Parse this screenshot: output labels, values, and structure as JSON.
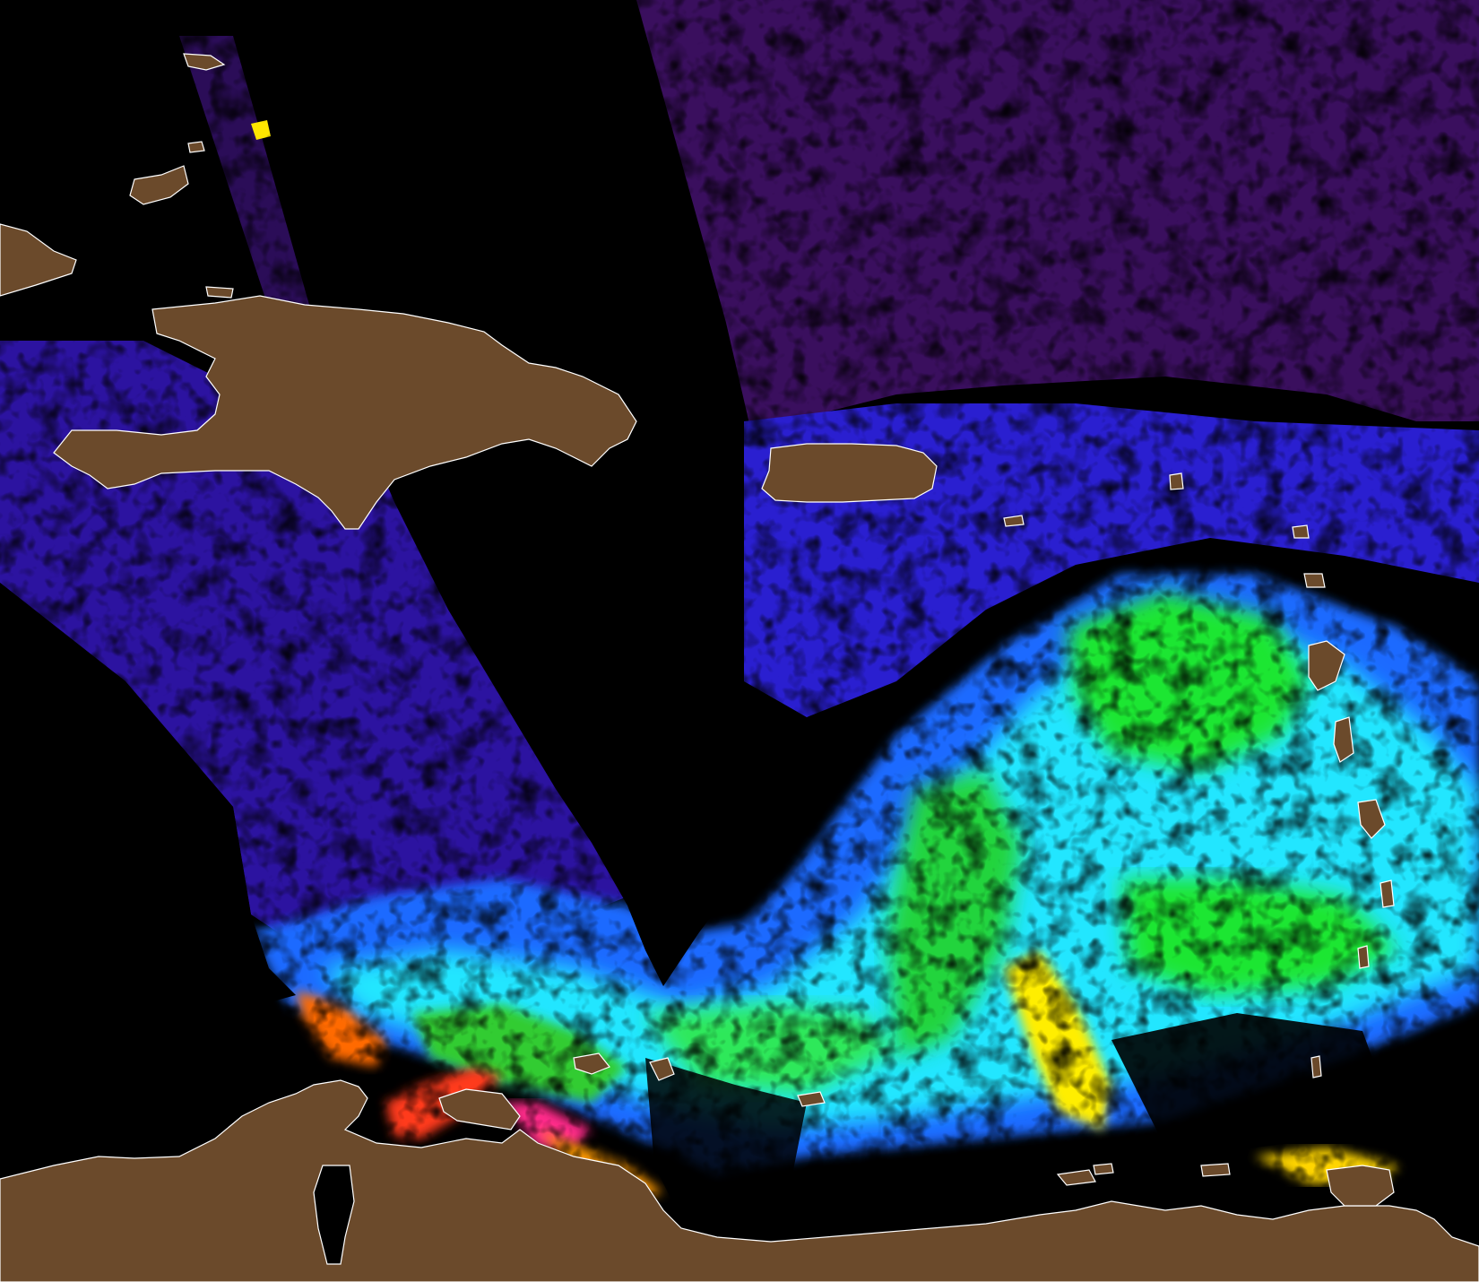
{
  "map": {
    "kind": "satellite ocean-color composite",
    "labels": [],
    "colors": {
      "no_data": "#000000",
      "land": "#6b4a2b",
      "coastline": "#ffffff",
      "low_concentration": "#3a0f5e",
      "low_mid": "#2a1fd0",
      "mid": "#1f6bff",
      "mid_high": "#22e6ff",
      "high": "#1fe632",
      "very_high": "#ffee00",
      "peak": "#ff3a1a",
      "extreme": "#ff2a8a"
    }
  }
}
